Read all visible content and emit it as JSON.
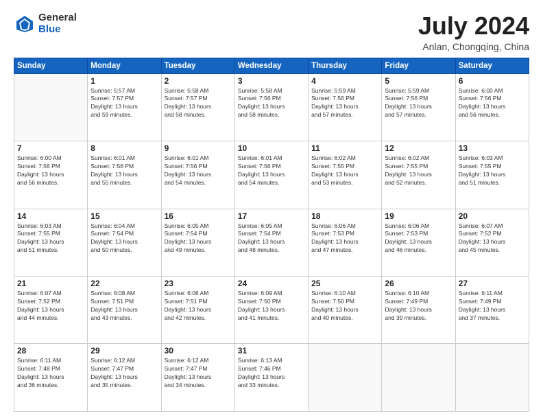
{
  "header": {
    "logo_general": "General",
    "logo_blue": "Blue",
    "month_title": "July 2024",
    "location": "Anlan, Chongqing, China"
  },
  "weekdays": [
    "Sunday",
    "Monday",
    "Tuesday",
    "Wednesday",
    "Thursday",
    "Friday",
    "Saturday"
  ],
  "weeks": [
    [
      {
        "day": "",
        "info": ""
      },
      {
        "day": "1",
        "info": "Sunrise: 5:57 AM\nSunset: 7:57 PM\nDaylight: 13 hours\nand 59 minutes."
      },
      {
        "day": "2",
        "info": "Sunrise: 5:58 AM\nSunset: 7:57 PM\nDaylight: 13 hours\nand 58 minutes."
      },
      {
        "day": "3",
        "info": "Sunrise: 5:58 AM\nSunset: 7:56 PM\nDaylight: 13 hours\nand 58 minutes."
      },
      {
        "day": "4",
        "info": "Sunrise: 5:59 AM\nSunset: 7:56 PM\nDaylight: 13 hours\nand 57 minutes."
      },
      {
        "day": "5",
        "info": "Sunrise: 5:59 AM\nSunset: 7:56 PM\nDaylight: 13 hours\nand 57 minutes."
      },
      {
        "day": "6",
        "info": "Sunrise: 6:00 AM\nSunset: 7:56 PM\nDaylight: 13 hours\nand 56 minutes."
      }
    ],
    [
      {
        "day": "7",
        "info": "Sunrise: 6:00 AM\nSunset: 7:56 PM\nDaylight: 13 hours\nand 56 minutes."
      },
      {
        "day": "8",
        "info": "Sunrise: 6:01 AM\nSunset: 7:56 PM\nDaylight: 13 hours\nand 55 minutes."
      },
      {
        "day": "9",
        "info": "Sunrise: 6:01 AM\nSunset: 7:56 PM\nDaylight: 13 hours\nand 54 minutes."
      },
      {
        "day": "10",
        "info": "Sunrise: 6:01 AM\nSunset: 7:56 PM\nDaylight: 13 hours\nand 54 minutes."
      },
      {
        "day": "11",
        "info": "Sunrise: 6:02 AM\nSunset: 7:55 PM\nDaylight: 13 hours\nand 53 minutes."
      },
      {
        "day": "12",
        "info": "Sunrise: 6:02 AM\nSunset: 7:55 PM\nDaylight: 13 hours\nand 52 minutes."
      },
      {
        "day": "13",
        "info": "Sunrise: 6:03 AM\nSunset: 7:55 PM\nDaylight: 13 hours\nand 51 minutes."
      }
    ],
    [
      {
        "day": "14",
        "info": "Sunrise: 6:03 AM\nSunset: 7:55 PM\nDaylight: 13 hours\nand 51 minutes."
      },
      {
        "day": "15",
        "info": "Sunrise: 6:04 AM\nSunset: 7:54 PM\nDaylight: 13 hours\nand 50 minutes."
      },
      {
        "day": "16",
        "info": "Sunrise: 6:05 AM\nSunset: 7:54 PM\nDaylight: 13 hours\nand 49 minutes."
      },
      {
        "day": "17",
        "info": "Sunrise: 6:05 AM\nSunset: 7:54 PM\nDaylight: 13 hours\nand 48 minutes."
      },
      {
        "day": "18",
        "info": "Sunrise: 6:06 AM\nSunset: 7:53 PM\nDaylight: 13 hours\nand 47 minutes."
      },
      {
        "day": "19",
        "info": "Sunrise: 6:06 AM\nSunset: 7:53 PM\nDaylight: 13 hours\nand 46 minutes."
      },
      {
        "day": "20",
        "info": "Sunrise: 6:07 AM\nSunset: 7:52 PM\nDaylight: 13 hours\nand 45 minutes."
      }
    ],
    [
      {
        "day": "21",
        "info": "Sunrise: 6:07 AM\nSunset: 7:52 PM\nDaylight: 13 hours\nand 44 minutes."
      },
      {
        "day": "22",
        "info": "Sunrise: 6:08 AM\nSunset: 7:51 PM\nDaylight: 13 hours\nand 43 minutes."
      },
      {
        "day": "23",
        "info": "Sunrise: 6:08 AM\nSunset: 7:51 PM\nDaylight: 13 hours\nand 42 minutes."
      },
      {
        "day": "24",
        "info": "Sunrise: 6:09 AM\nSunset: 7:50 PM\nDaylight: 13 hours\nand 41 minutes."
      },
      {
        "day": "25",
        "info": "Sunrise: 6:10 AM\nSunset: 7:50 PM\nDaylight: 13 hours\nand 40 minutes."
      },
      {
        "day": "26",
        "info": "Sunrise: 6:10 AM\nSunset: 7:49 PM\nDaylight: 13 hours\nand 39 minutes."
      },
      {
        "day": "27",
        "info": "Sunrise: 6:11 AM\nSunset: 7:49 PM\nDaylight: 13 hours\nand 37 minutes."
      }
    ],
    [
      {
        "day": "28",
        "info": "Sunrise: 6:11 AM\nSunset: 7:48 PM\nDaylight: 13 hours\nand 36 minutes."
      },
      {
        "day": "29",
        "info": "Sunrise: 6:12 AM\nSunset: 7:47 PM\nDaylight: 13 hours\nand 35 minutes."
      },
      {
        "day": "30",
        "info": "Sunrise: 6:12 AM\nSunset: 7:47 PM\nDaylight: 13 hours\nand 34 minutes."
      },
      {
        "day": "31",
        "info": "Sunrise: 6:13 AM\nSunset: 7:46 PM\nDaylight: 13 hours\nand 33 minutes."
      },
      {
        "day": "",
        "info": ""
      },
      {
        "day": "",
        "info": ""
      },
      {
        "day": "",
        "info": ""
      }
    ]
  ]
}
